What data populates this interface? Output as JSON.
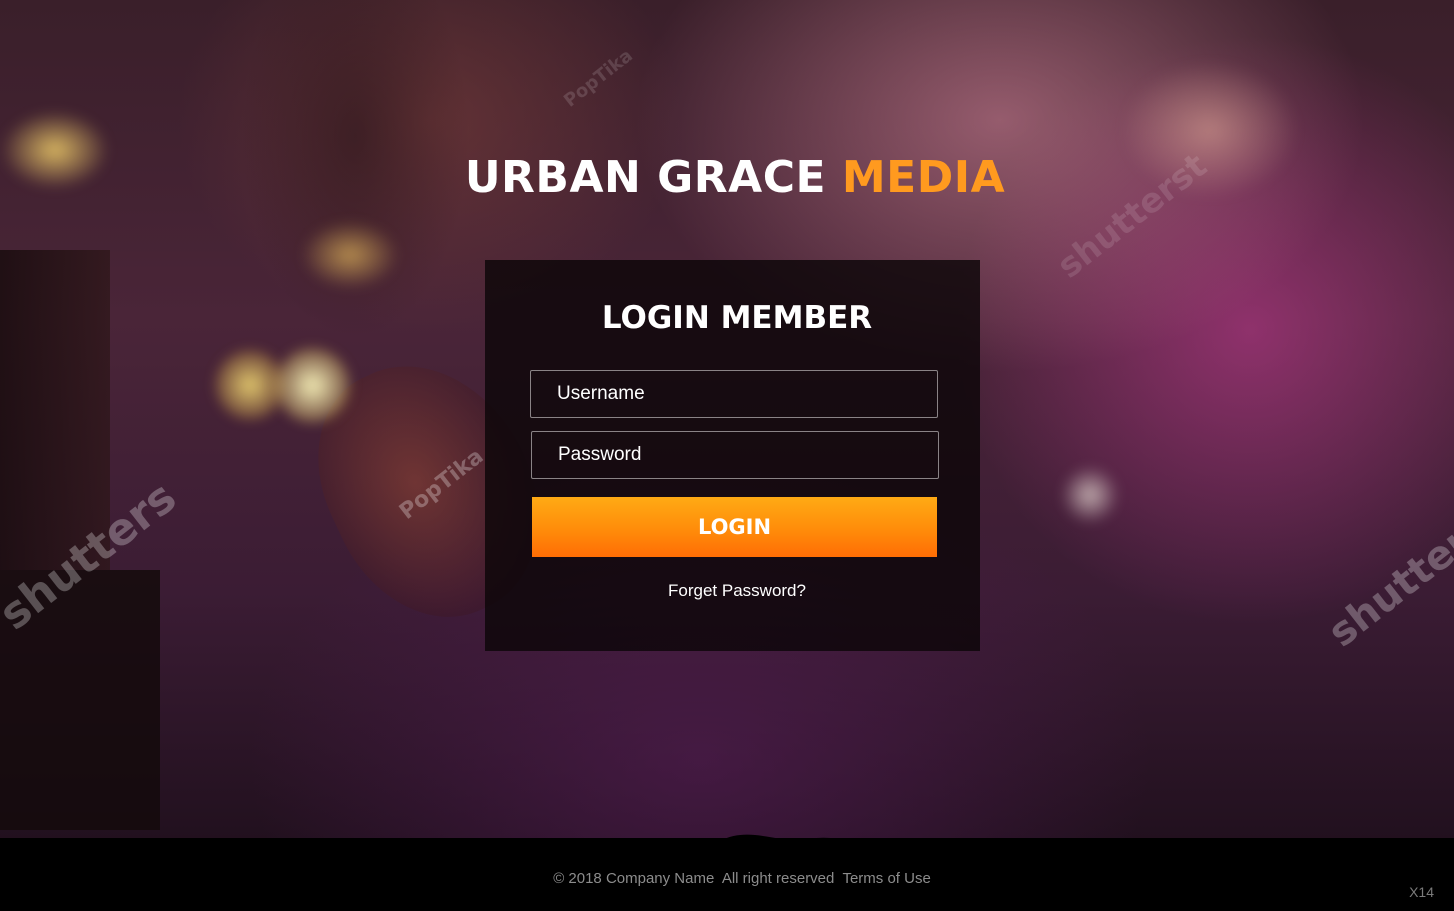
{
  "brand": {
    "name_primary": "URBAN GRACE",
    "name_accent": "MEDIA",
    "accent_color": "#ff9a1f"
  },
  "login": {
    "title": "LOGIN MEMBER",
    "username_placeholder": "Username",
    "password_placeholder": "Password",
    "login_button": "LOGIN",
    "forgot_link": "Forget Password?"
  },
  "footer": {
    "copyright": "© 2018 Company Name  All right reserved  ",
    "terms": "Terms of Use",
    "tag": "X14"
  },
  "watermarks": {
    "poptika_1": "PopTika",
    "poptika_2": "PopTika",
    "shutterstock_1": "shutters",
    "shutterstock_2": "shutters",
    "shutterstock_3": "shutterst"
  },
  "colors": {
    "button_top": "#ffaa14",
    "button_bottom": "#ff6d05"
  }
}
